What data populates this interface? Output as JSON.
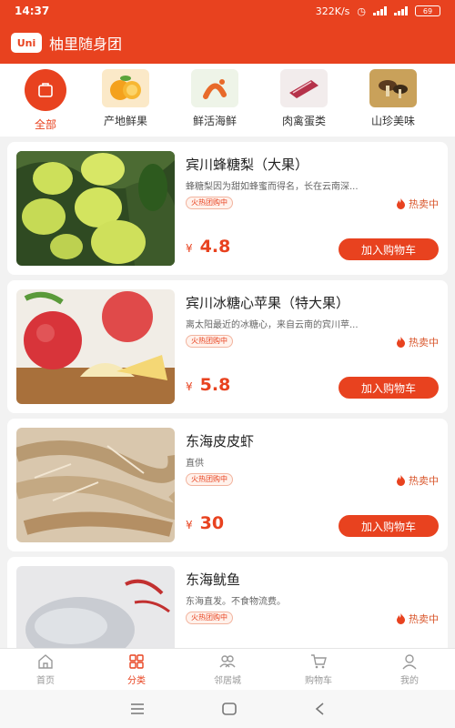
{
  "status_bar": {
    "time": "14:37",
    "net_speed": "322K/s",
    "battery": "69"
  },
  "header": {
    "logo_text": "Uni",
    "title": "柚里随身团"
  },
  "categories": [
    {
      "label": "全部",
      "icon": "all-icon",
      "active": true
    },
    {
      "label": "产地鲜果",
      "icon": "orange-icon",
      "active": false
    },
    {
      "label": "鲜活海鲜",
      "icon": "seafood-icon",
      "active": false
    },
    {
      "label": "肉禽蛋类",
      "icon": "meat-icon",
      "active": false
    },
    {
      "label": "山珍美味",
      "icon": "mushroom-icon",
      "active": false
    }
  ],
  "products": [
    {
      "title": "宾川蜂糖梨（大果）",
      "desc": "蜂糖梨因为甜如蜂蜜而得名，长在云南深...",
      "tag": "火热团购中",
      "hot": "热卖中",
      "currency": "¥",
      "price": "4.8",
      "button": "加入购物车",
      "image": "pear-image"
    },
    {
      "title": "宾川冰糖心苹果（特大果）",
      "desc": "离太阳最近的冰糖心，来自云南的宾川苹...",
      "tag": "火热团购中",
      "hot": "热卖中",
      "currency": "¥",
      "price": "5.8",
      "button": "加入购物车",
      "image": "apple-image"
    },
    {
      "title": "东海皮皮虾",
      "desc": "直供",
      "tag": "火热团购中",
      "hot": "热卖中",
      "currency": "¥",
      "price": "30",
      "button": "加入购物车",
      "image": "mantis-shrimp-image"
    },
    {
      "title": "东海鱿鱼",
      "desc": "东海直发。不食物流费。",
      "tag": "火热团购中",
      "hot": "热卖中",
      "currency": "",
      "price": "",
      "button": "",
      "image": "squid-image"
    }
  ],
  "tabs": [
    {
      "label": "首页",
      "icon": "home-icon",
      "active": false
    },
    {
      "label": "分类",
      "icon": "category-icon",
      "active": true
    },
    {
      "label": "邻居城",
      "icon": "neighbors-icon",
      "active": false
    },
    {
      "label": "购物车",
      "icon": "cart-icon",
      "active": false
    },
    {
      "label": "我的",
      "icon": "profile-icon",
      "active": false
    }
  ],
  "colors": {
    "primary": "#e8421f",
    "background": "#f2f2f2"
  }
}
